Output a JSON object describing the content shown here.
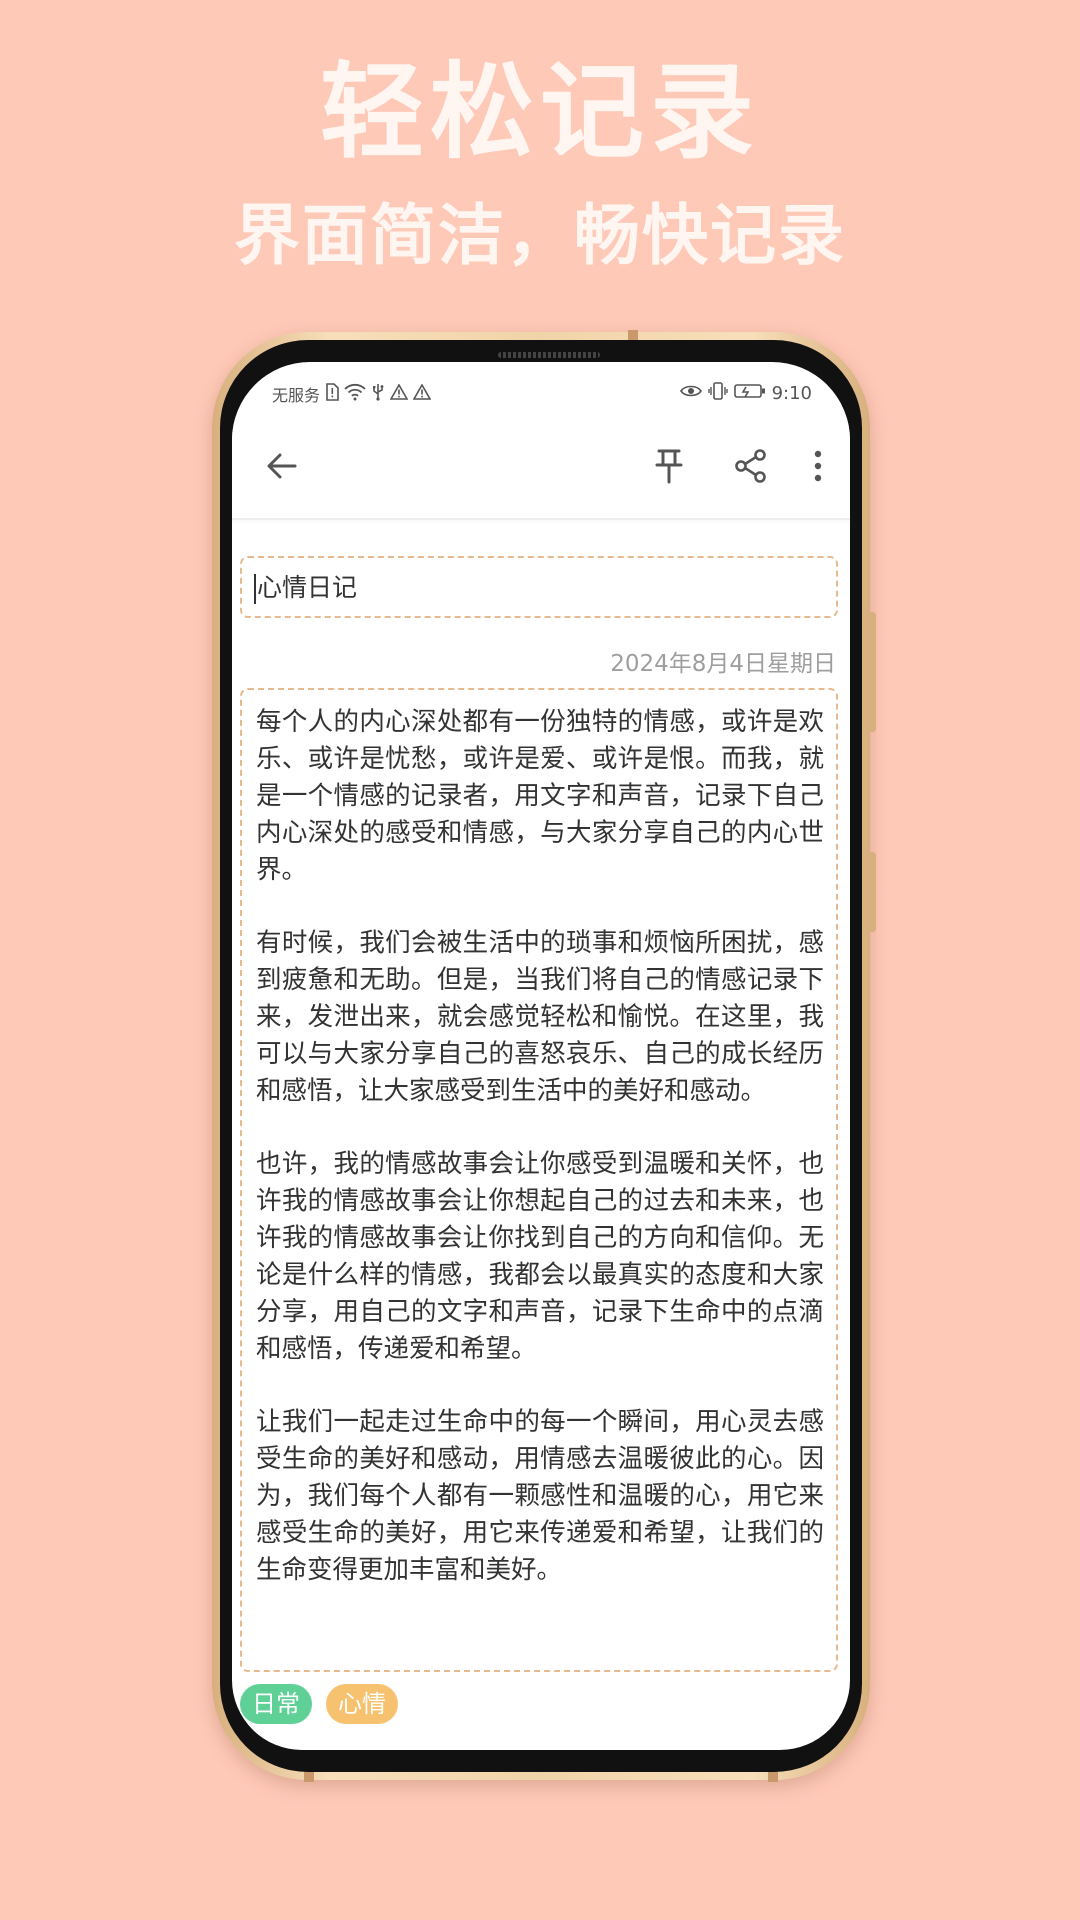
{
  "promo": {
    "headline": "轻松记录",
    "subheadline": "界面简洁，畅快记录"
  },
  "status_bar": {
    "carrier": "无服务",
    "time": "9:10"
  },
  "app_bar": {
    "back_icon": "arrow-left-icon",
    "pin_icon": "pin-icon",
    "share_icon": "share-icon",
    "more_icon": "more-vertical-icon"
  },
  "note": {
    "title": "心情日记",
    "date": "2024年8月4日星期日",
    "paragraphs": [
      "每个人的内心深处都有一份独特的情感，或许是欢乐、或许是忧愁，或许是爱、或许是恨。而我，就是一个情感的记录者，用文字和声音，记录下自己内心深处的感受和情感，与大家分享自己的内心世界。",
      "有时候，我们会被生活中的琐事和烦恼所困扰，感到疲惫和无助。但是，当我们将自己的情感记录下来，发泄出来，就会感觉轻松和愉悦。在这里，我可以与大家分享自己的喜怒哀乐、自己的成长经历和感悟，让大家感受到生活中的美好和感动。",
      "也许，我的情感故事会让你感受到温暖和关怀，也许我的情感故事会让你想起自己的过去和未来，也许我的情感故事会让你找到自己的方向和信仰。无论是什么样的情感，我都会以最真实的态度和大家分享，用自己的文字和声音，记录下生命中的点滴和感悟，传递爱和希望。",
      "让我们一起走过生命中的每一个瞬间，用心灵去感受生命的美好和感动，用情感去温暖彼此的心。因为，我们每个人都有一颗感性和温暖的心，用它来感受生命的美好，用它来传递爱和希望，让我们的生命变得更加丰富和美好。"
    ],
    "tags": [
      "日常",
      "心情"
    ]
  },
  "colors": {
    "background": "#ffc9b8",
    "dashed_border": "#e8b98e",
    "tag_green": "#5fd197",
    "tag_orange": "#f6c270"
  }
}
